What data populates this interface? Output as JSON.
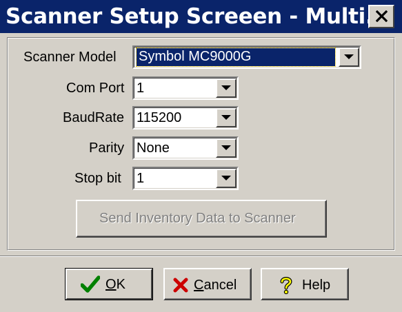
{
  "window": {
    "title": "Scanner Setup Screeen - Multi...",
    "close_glyph": "✕"
  },
  "fields": {
    "scanner_model": {
      "label": "Scanner Model",
      "value": "Symbol MC9000G"
    },
    "com_port": {
      "label": "Com Port",
      "value": "1"
    },
    "baud_rate": {
      "label": "BaudRate",
      "value": "115200"
    },
    "parity": {
      "label": "Parity",
      "value": "None"
    },
    "stop_bit": {
      "label": "Stop bit",
      "value": "1"
    }
  },
  "send_button": {
    "label": "Send Inventory Data to Scanner",
    "enabled": false
  },
  "footer": {
    "ok": {
      "label": "OK",
      "mnemonic": "O",
      "icon": "checkmark-icon"
    },
    "cancel": {
      "label": "Cancel",
      "mnemonic": "C",
      "icon": "x-icon"
    },
    "help": {
      "label": "Help",
      "icon": "question-icon"
    }
  },
  "colors": {
    "titlebar": "#0a246a",
    "face": "#d4d0c8",
    "selection": "#0a246a",
    "check_green": "#008000",
    "cancel_red": "#cc0000",
    "help_yellow": "#ffff00"
  }
}
